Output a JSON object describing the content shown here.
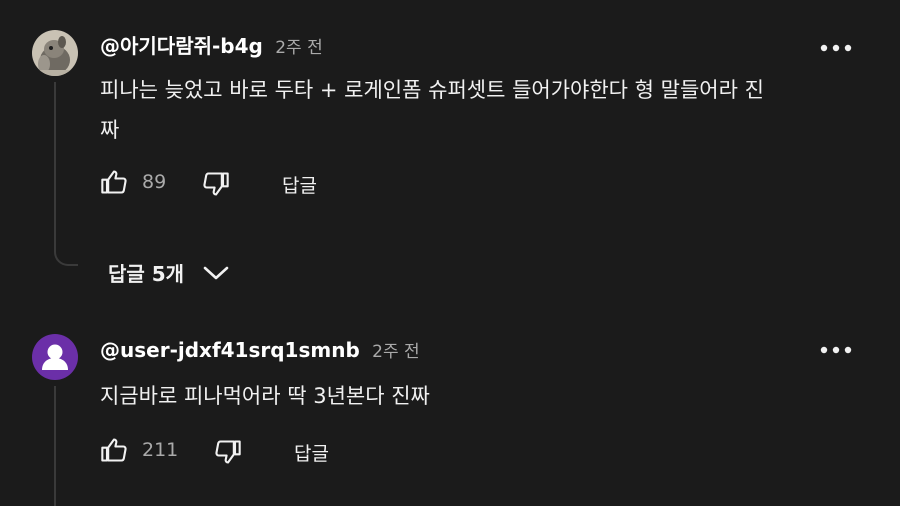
{
  "comments": [
    {
      "author": "@아기다람쥐-b4g",
      "time": "2주 전",
      "text_line1": "피나는 늦었고 바로 두타 + 로게인폼 슈퍼셋트 들어가야한다 형 말들어라 진",
      "text_line2": "짜",
      "likes": "89",
      "reply_label": "답글",
      "replies_toggle": "답글 5개",
      "avatar_icon": "squirrel-avatar-icon"
    },
    {
      "author": "@user-jdxf41srq1smnb",
      "time": "2주 전",
      "text_line1": "지금바로 피나먹어라 딱 3년본다 진짜",
      "likes": "211",
      "reply_label": "답글",
      "avatar_icon": "default-user-avatar-icon",
      "avatar_color": "#6b2fa8"
    }
  ],
  "icons": {
    "more": "more-vert-icon",
    "like": "thumbs-up-icon",
    "dislike": "thumbs-down-icon",
    "expand": "chevron-down-icon"
  },
  "colors": {
    "background": "#1b1b1b",
    "text": "#f1f1f1",
    "muted": "#aaaaaa"
  }
}
